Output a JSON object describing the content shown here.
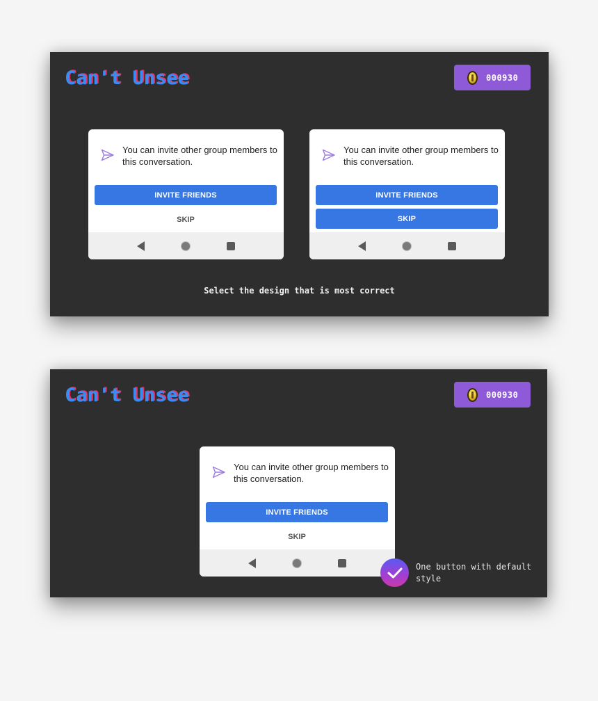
{
  "app": {
    "logo": "Can't Unsee",
    "coins": "000930",
    "brand_colors": {
      "logo_blue": "#3b8cf2",
      "logo_red": "#e5356b",
      "badge_purple": "#8e5ad8",
      "button_blue": "#3677e3"
    }
  },
  "dialog": {
    "message": "You can invite other group members to this conversation.",
    "primary_label": "INVITE FRIENDS",
    "secondary_label": "SKIP",
    "icon": "send-icon"
  },
  "question": {
    "prompt": "Select the design that is most correct"
  },
  "result": {
    "icon": "check-icon",
    "feedback": "One button with default style"
  },
  "navbar": {
    "back": "back-icon",
    "home": "home-icon",
    "recents": "recents-icon"
  }
}
